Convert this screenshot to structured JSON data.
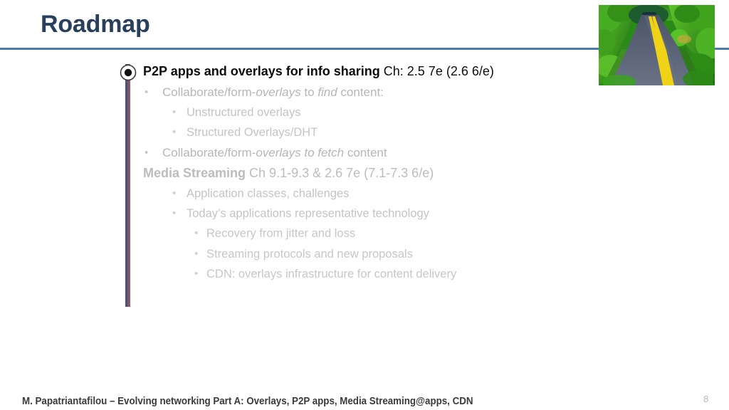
{
  "slide": {
    "title": "Roadmap",
    "page_number": "8",
    "footer": "M. Papatriantafilou –  Evolving networking Part A: Overlays, P2P apps, Media Streaming@apps, CDN"
  },
  "colors": {
    "title": "#28405c",
    "rule": "#4b7ab5",
    "accent_bar_left": "#3d4f73",
    "accent_bar_right": "#8a5f68",
    "body_active": "#0d0d0d",
    "body_dim": "#bcbcbc",
    "footer": "#3b3b3b",
    "page_number": "#b9b9b9"
  },
  "photo": {
    "alt": "road-through-green-forest-photo",
    "sky": "#2f6f8f",
    "foliage_dark": "#1d6b12",
    "foliage_light": "#5fc22a",
    "road": "#5a6478",
    "road_line": "#f0d216"
  },
  "content": {
    "items": [
      {
        "level": 1,
        "bullet": "marker",
        "tone": "black",
        "runs": [
          {
            "text": "P2P apps and overlays  for info sharing",
            "bold": true,
            "italic": false
          },
          {
            "text": " Ch: 2.5 7e (2.6 6/e)",
            "bold": false,
            "italic": false
          }
        ]
      },
      {
        "level": 2,
        "bullet": "•",
        "tone": "dim",
        "runs": [
          {
            "text": "Collaborate/form-",
            "bold": false,
            "italic": false
          },
          {
            "text": "overlays",
            "bold": false,
            "italic": true
          },
          {
            "text": " to ",
            "bold": false,
            "italic": false
          },
          {
            "text": "find",
            "bold": false,
            "italic": true
          },
          {
            "text": " content:",
            "bold": false,
            "italic": false
          }
        ]
      },
      {
        "level": 3,
        "bullet": "•",
        "tone": "dim",
        "runs": [
          {
            "text": "Unstructured overlays",
            "bold": false,
            "italic": false
          }
        ]
      },
      {
        "level": 3,
        "bullet": "•",
        "tone": "dim",
        "runs": [
          {
            "text": "Structured Overlays/DHT",
            "bold": false,
            "italic": false
          }
        ]
      },
      {
        "level": 2,
        "bullet": "•",
        "tone": "dim",
        "runs": [
          {
            "text": "Collaborate/form-",
            "bold": false,
            "italic": false
          },
          {
            "text": "overlays to fetch",
            "bold": false,
            "italic": true
          },
          {
            "text": " content",
            "bold": false,
            "italic": false
          }
        ]
      },
      {
        "level": 1,
        "bullet": "none",
        "tone": "dim",
        "runs": [
          {
            "text": "Media Streaming",
            "bold": true,
            "italic": false
          },
          {
            "text": " Ch 9.1-9.3 & 2.6 7e (7.1-7.3 6/e)",
            "bold": false,
            "italic": false
          }
        ]
      },
      {
        "level": 3,
        "bullet": "•",
        "tone": "dim",
        "runs": [
          {
            "text": "Application classes, challenges",
            "bold": false,
            "italic": false
          }
        ]
      },
      {
        "level": 3,
        "bullet": "•",
        "tone": "dim",
        "runs": [
          {
            "text": "Today’s applications representative technology",
            "bold": false,
            "italic": false
          }
        ]
      },
      {
        "level": 4,
        "bullet": "•",
        "tone": "dim",
        "runs": [
          {
            "text": "Recovery from jitter and loss",
            "bold": false,
            "italic": false
          }
        ]
      },
      {
        "level": 4,
        "bullet": "•",
        "tone": "dim",
        "runs": [
          {
            "text": "Streaming protocols and new proposals",
            "bold": false,
            "italic": false
          }
        ]
      },
      {
        "level": 4,
        "bullet": "•",
        "tone": "dim",
        "runs": [
          {
            "text": "CDN: overlays infrastructure for content delivery",
            "bold": false,
            "italic": false
          }
        ]
      }
    ]
  }
}
